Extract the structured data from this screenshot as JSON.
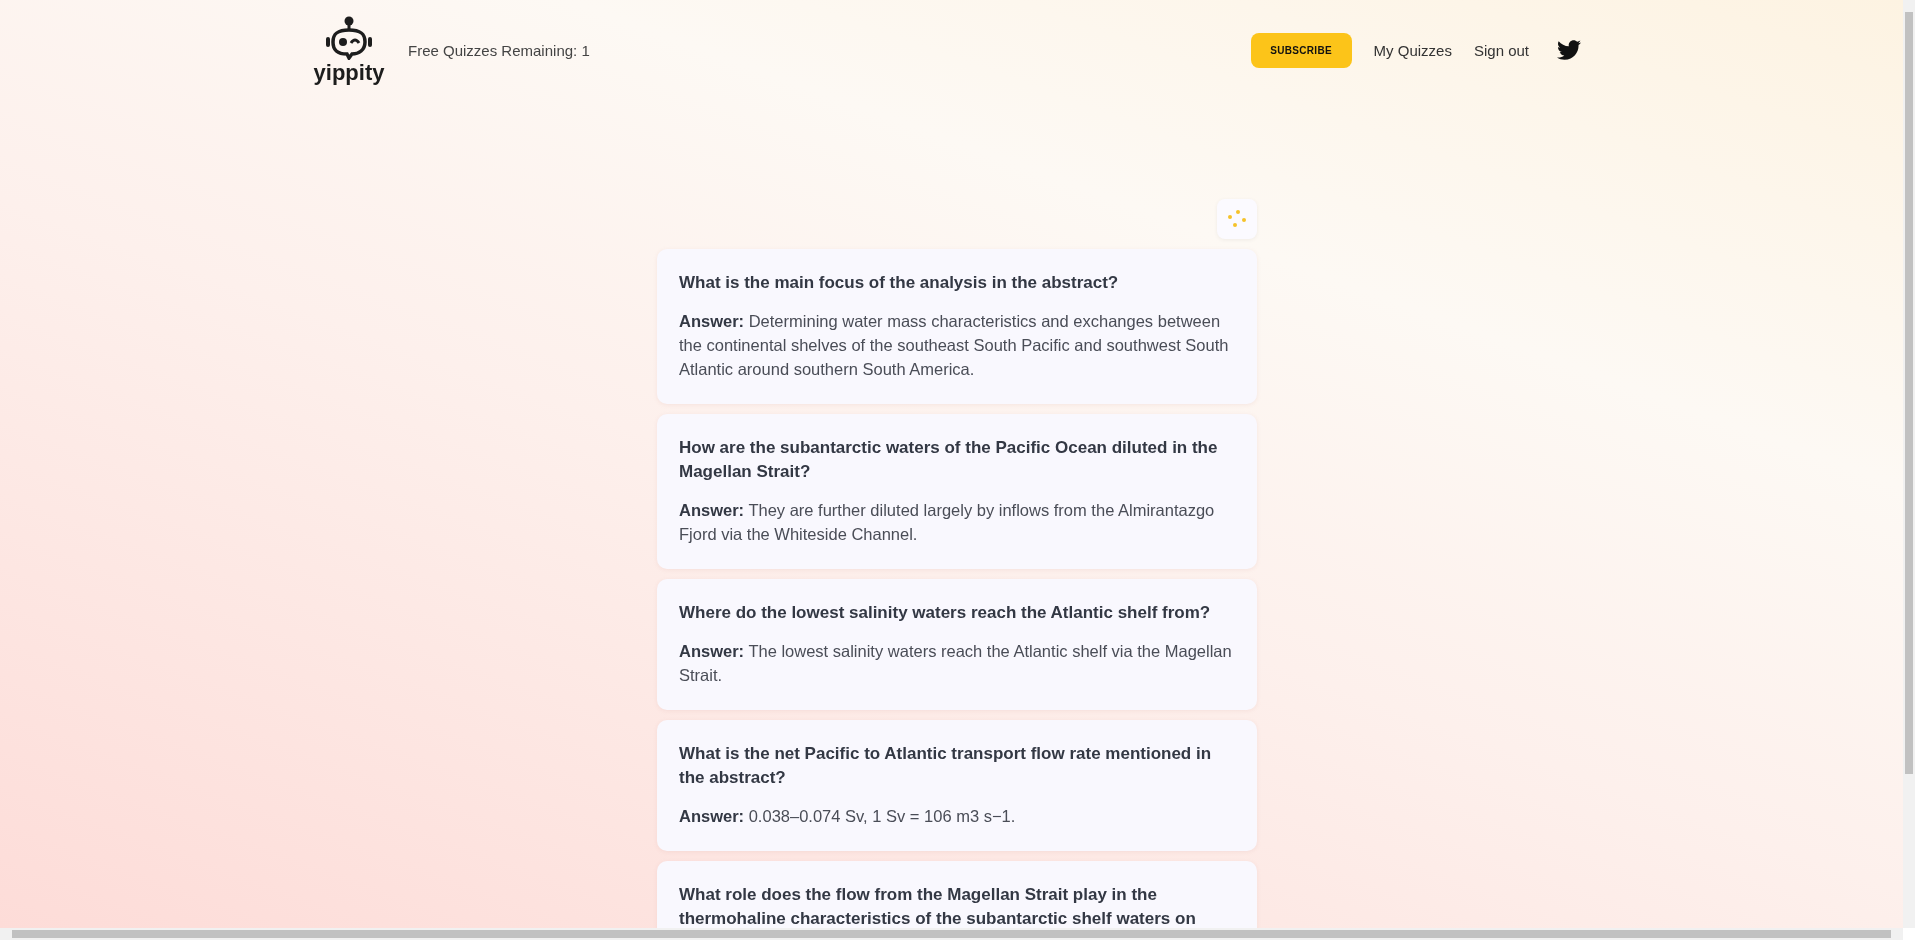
{
  "header": {
    "logo_text": "yippity",
    "quota": "Free Quizzes Remaining: 1",
    "subscribe": "SUBSCRIBE",
    "links": [
      "My Quizzes",
      "Sign out"
    ]
  },
  "cards": [
    {
      "question": "What is the main focus of the analysis in the abstract?",
      "answer": "**Answer:** Determining water mass characteristics and exchanges between the continental shelves of the southeast South Pacific and southwest South Atlantic around southern South America."
    },
    {
      "question": "How are the subantarctic waters of the Pacific Ocean diluted in the Magellan Strait?",
      "answer": "**Answer:** They are further diluted largely by inflows from the Almirantazgo Fjord via the Whiteside Channel."
    },
    {
      "question": "Where do the lowest salinity waters reach the Atlantic shelf from?",
      "answer": "**Answer:** The lowest salinity waters reach the Atlantic shelf via the Magellan Strait."
    },
    {
      "question": "What is the net Pacific to Atlantic transport flow rate mentioned in the abstract?",
      "answer": "**Answer:** 0.038–0.074 Sv, 1 Sv = 106 m3 s−1."
    },
    {
      "question": "What role does the flow from the Magellan Strait play in the thermohaline characteristics of the subantarctic shelf waters on"
    }
  ]
}
